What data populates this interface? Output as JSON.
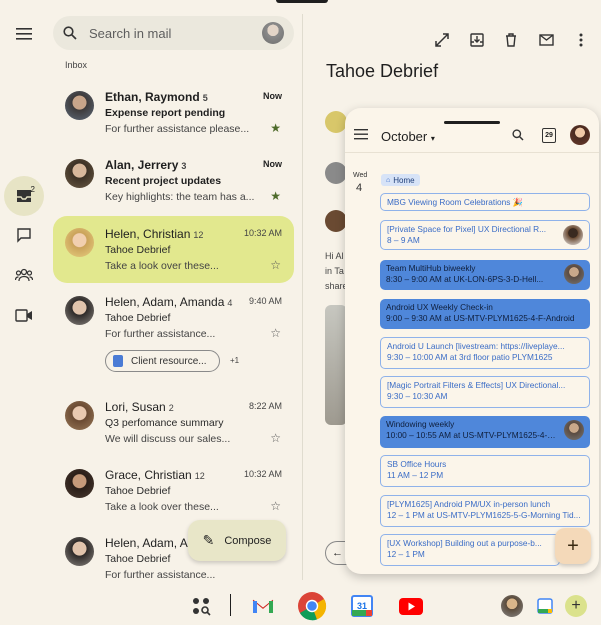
{
  "search": {
    "placeholder": "Search in mail"
  },
  "inbox_label": "Inbox",
  "rail": {
    "mail_badge": "2"
  },
  "emails": [
    {
      "sender": "Ethan, Raymond",
      "count": "5",
      "time": "Now",
      "subject": "Expense report pending",
      "snippet": "For further assistance please...",
      "starred": true,
      "unread": true
    },
    {
      "sender": "Alan, Jerrery",
      "count": "3",
      "time": "Now",
      "subject": "Recent project updates",
      "snippet": "Key highlights: the team has a...",
      "starred": true,
      "unread": true
    },
    {
      "sender": "Helen, Christian",
      "count": "12",
      "time": "10:32 AM",
      "subject": "Tahoe Debrief",
      "snippet": "Take a look over these...",
      "starred": false,
      "unread": false,
      "selected": true
    },
    {
      "sender": "Helen, Adam, Amanda",
      "count": "4",
      "time": "9:40 AM",
      "subject": "Tahoe Debrief",
      "snippet": "For further assistance...",
      "starred": false,
      "unread": false,
      "attachment": "Client resource...",
      "attachment_more": "+1"
    },
    {
      "sender": "Lori, Susan",
      "count": "2",
      "time": "8:22 AM",
      "subject": "Q3 perfomance summary",
      "snippet": "We will discuss our sales...",
      "starred": false,
      "unread": false
    },
    {
      "sender": "Grace, Christian",
      "count": "12",
      "time": "10:32 AM",
      "subject": "Tahoe Debrief",
      "snippet": "Take a look over these...",
      "starred": false,
      "unread": false
    },
    {
      "sender": "Helen, Adam, Ar",
      "count": "",
      "time": "",
      "subject": "Tahoe Debrief",
      "snippet": "For further assistance...",
      "starred": false,
      "unread": false
    }
  ],
  "compose": {
    "label": "Compose"
  },
  "detail": {
    "title": "Tahoe Debrief",
    "body_fragments": [
      "Hi Al",
      "in Ta",
      "share"
    ]
  },
  "calendar": {
    "month": "October",
    "today_icon": "29",
    "day_of_week": "Wed",
    "day_of_month": "4",
    "location_chip": "Home",
    "events": [
      {
        "title": "MBG Viewing Room Celebrations 🎉",
        "time": "",
        "style": "outline",
        "avatar": false
      },
      {
        "title": "[Private Space for Pixel] UX Directional R...",
        "time": "8 – 9 AM",
        "style": "outline",
        "avatar": true
      },
      {
        "title": "Team MultiHub biweekly",
        "time": "8:30 – 9:00 AM at UK-LON-6PS-3-D-Hell...",
        "style": "solid",
        "avatar": true
      },
      {
        "title": "Android UX Weekly Check-in",
        "time": "9:00 – 9:30 AM at US-MTV-PLYM1625-4-F-Android",
        "style": "solid",
        "avatar": false
      },
      {
        "title": "Android U Launch [livestream: https://liveplaye...",
        "time": "9:30 – 10:00 AM at 3rd floor patio PLYM1625",
        "style": "outline",
        "avatar": false
      },
      {
        "title": "[Magic Portrait Filters & Effects] UX Directional...",
        "time": "9:30 – 10:30 AM",
        "style": "outline",
        "avatar": false
      },
      {
        "title": "Windowing weekly",
        "time": "10:00 – 10:55 AM at US-MTV-PLYM1625-4-Android",
        "style": "solid",
        "avatar": true
      },
      {
        "title": "SB Office Hours",
        "time": "11 AM – 12 PM",
        "style": "outline",
        "avatar": false
      },
      {
        "title": "[PLYM1625] Android PM/UX in-person lunch",
        "time": "12 – 1 PM at US-MTV-PLYM1625-5-G-Morning Tid...",
        "style": "outline",
        "avatar": false
      },
      {
        "title": "[UX Workshop] Building out a purpose-b...",
        "time": "12 – 1 PM",
        "style": "outline",
        "avatar": false
      }
    ]
  },
  "colors": {
    "selected_row": "#e2e88e",
    "event_blue": "#4f87da",
    "background": "#f7f2e8"
  }
}
